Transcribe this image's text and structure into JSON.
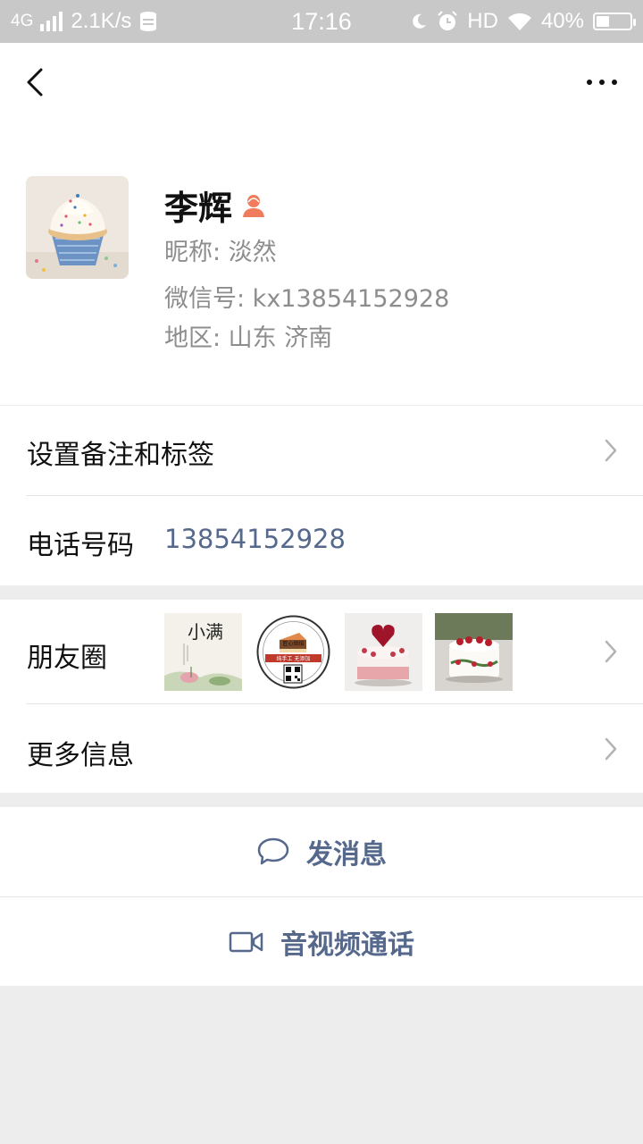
{
  "status_bar": {
    "network": "4G",
    "speed": "2.1K/s",
    "time": "17:16",
    "hd": "HD",
    "battery": "40%"
  },
  "profile": {
    "name": "李辉",
    "nickname": "昵称:  淡然",
    "wechat_id": "微信号:  kx13854152928",
    "region": "地区:  山东  济南"
  },
  "rows": {
    "remark_label": "设置备注和标签",
    "phone_label": "电话号码",
    "phone_value": "13854152928",
    "moments_label": "朋友圈",
    "more_info_label": "更多信息"
  },
  "moments_thumbnails": [
    {
      "label": "小满"
    },
    {
      "label": "匠心烘焙",
      "caption": "纯手工 无添加"
    },
    {
      "label": "heart-cake"
    },
    {
      "label": "strawberry-cake"
    }
  ],
  "actions": {
    "message": "发消息",
    "video_call": "音视频通话"
  },
  "colors": {
    "link_blue": "#56698c",
    "gray_text": "#8d8d8d",
    "page_bg": "#ededed",
    "gender_icon": "#f07c5d"
  }
}
